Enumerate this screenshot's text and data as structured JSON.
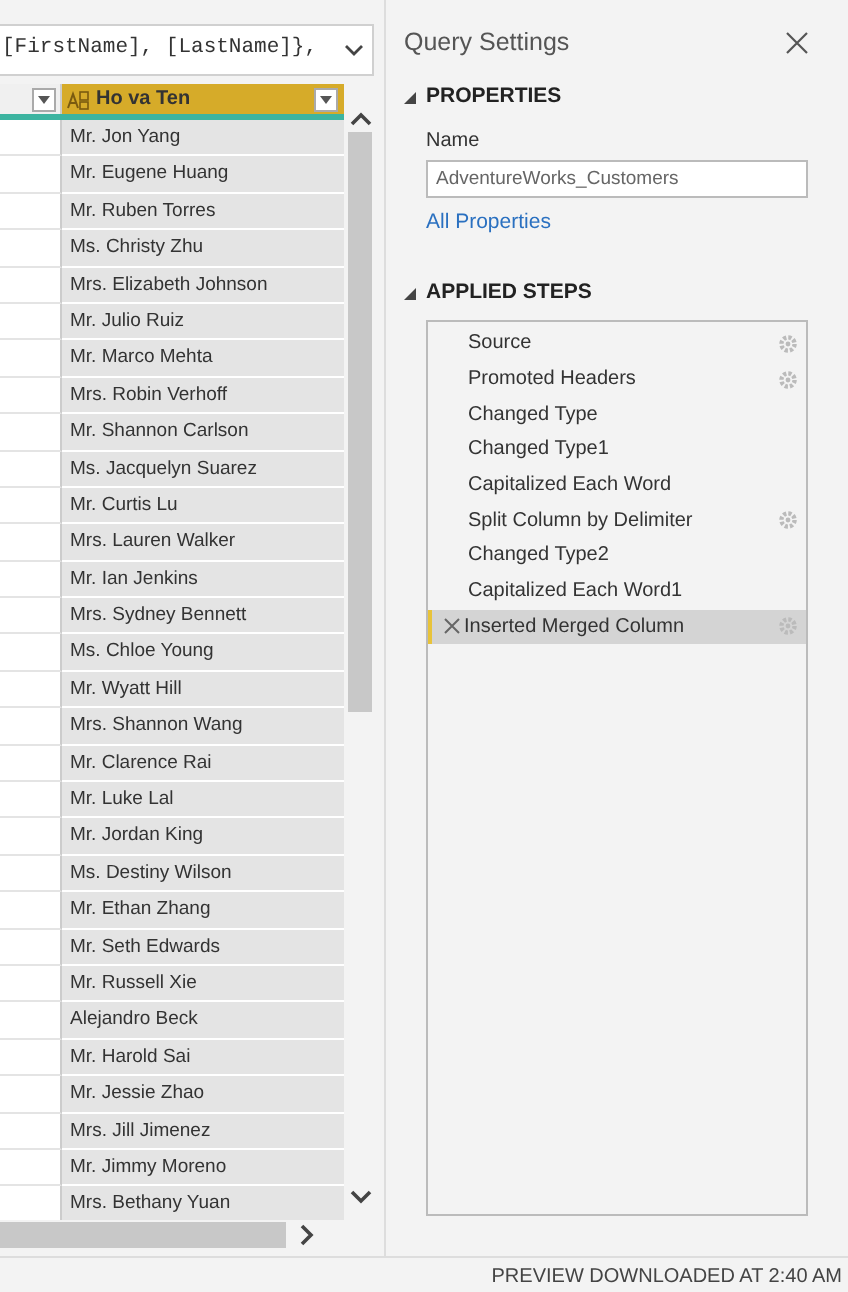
{
  "formula_bar": {
    "text": "[FirstName], [LastName]},",
    "expanded": false
  },
  "grid": {
    "column_header": {
      "label": "Ho va Ten",
      "selected": true
    },
    "rows": [
      "Mr. Jon Yang",
      "Mr. Eugene Huang",
      "Mr. Ruben Torres",
      "Ms. Christy Zhu",
      "Mrs. Elizabeth Johnson",
      "Mr. Julio Ruiz",
      "Mr. Marco Mehta",
      "Mrs. Robin Verhoff",
      "Mr. Shannon Carlson",
      "Ms. Jacquelyn Suarez",
      "Mr. Curtis Lu",
      "Mrs. Lauren Walker",
      "Mr. Ian Jenkins",
      "Mrs. Sydney Bennett",
      "Ms. Chloe Young",
      "Mr. Wyatt Hill",
      "Mrs. Shannon Wang",
      "Mr. Clarence Rai",
      "Mr. Luke Lal",
      "Mr. Jordan King",
      "Ms. Destiny Wilson",
      "Mr. Ethan Zhang",
      "Mr. Seth Edwards",
      "Mr. Russell Xie",
      "Alejandro Beck",
      "Mr. Harold Sai",
      "Mr. Jessie Zhao",
      "Mrs. Jill Jimenez",
      "Mr. Jimmy Moreno",
      "Mrs. Bethany Yuan"
    ]
  },
  "query_settings": {
    "title": "Query Settings",
    "properties": {
      "heading": "PROPERTIES",
      "expanded": true,
      "name_label": "Name",
      "name_value": "AdventureWorks_Customers",
      "link": "All Properties"
    },
    "applied_steps": {
      "heading": "APPLIED STEPS",
      "expanded": true,
      "steps": [
        {
          "label": "Source",
          "has_settings": true,
          "selected": false
        },
        {
          "label": "Promoted Headers",
          "has_settings": true,
          "selected": false
        },
        {
          "label": "Changed Type",
          "has_settings": false,
          "selected": false
        },
        {
          "label": "Changed Type1",
          "has_settings": false,
          "selected": false
        },
        {
          "label": "Capitalized Each Word",
          "has_settings": false,
          "selected": false
        },
        {
          "label": "Split Column by Delimiter",
          "has_settings": true,
          "selected": false
        },
        {
          "label": "Changed Type2",
          "has_settings": false,
          "selected": false
        },
        {
          "label": "Capitalized Each Word1",
          "has_settings": false,
          "selected": false
        },
        {
          "label": "Inserted Merged Column",
          "has_settings": true,
          "selected": true
        }
      ]
    }
  },
  "status_bar": {
    "text": "PREVIEW DOWNLOADED AT 2:40 AM"
  }
}
